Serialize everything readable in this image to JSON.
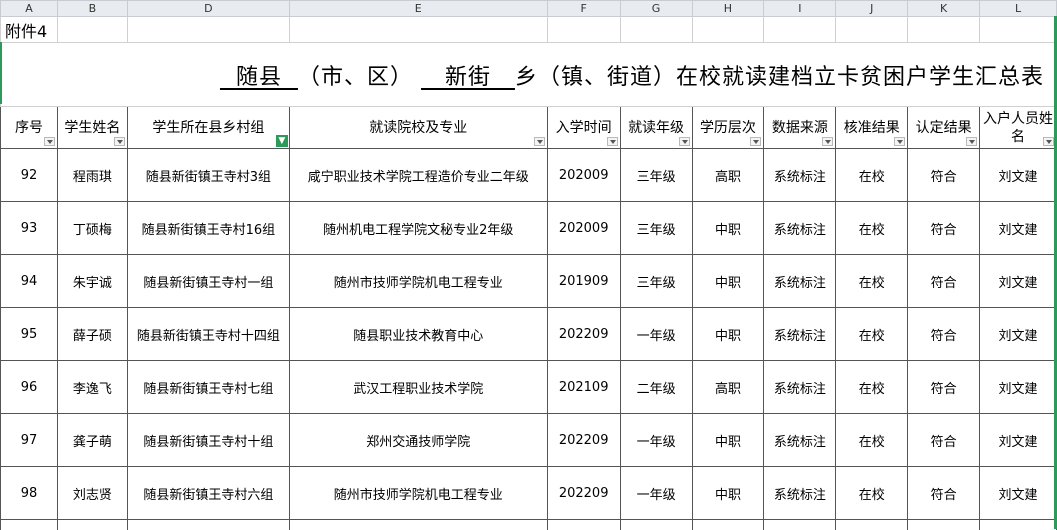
{
  "column_headers": [
    "A",
    "B",
    "D",
    "E",
    "F",
    "G",
    "H",
    "I",
    "J",
    "K",
    "L"
  ],
  "attachment_label": "附件4",
  "title": {
    "county": "随县",
    "part1": "（市、区）",
    "town": "新街",
    "part2": "乡（镇、街道）在校就读建档立卡贫困户学生汇总表"
  },
  "table_headers": [
    "序号",
    "学生姓名",
    "学生所在县乡村组",
    "就读院校及专业",
    "入学时间",
    "就读年级",
    "学历层次",
    "数据来源",
    "核准结果",
    "认定结果",
    "入户人员姓名"
  ],
  "rows": [
    {
      "no": "92",
      "name": "程雨琪",
      "village": "随县新街镇王寺村3组",
      "school": "咸宁职业技术学院工程造价专业二年级",
      "enroll": "202009",
      "grade": "三年级",
      "level": "高职",
      "source": "系统标注",
      "check": "在校",
      "result": "符合",
      "visitor": "刘文建"
    },
    {
      "no": "93",
      "name": "丁硕梅",
      "village": "随县新街镇王寺村16组",
      "school": "随州机电工程学院文秘专业2年级",
      "enroll": "202009",
      "grade": "三年级",
      "level": "中职",
      "source": "系统标注",
      "check": "在校",
      "result": "符合",
      "visitor": "刘文建"
    },
    {
      "no": "94",
      "name": "朱宇诚",
      "village": "随县新街镇王寺村一组",
      "school": "随州市技师学院机电工程专业",
      "enroll": "201909",
      "grade": "三年级",
      "level": "中职",
      "source": "系统标注",
      "check": "在校",
      "result": "符合",
      "visitor": "刘文建"
    },
    {
      "no": "95",
      "name": "薛子硕",
      "village": "随县新街镇王寺村十四组",
      "school": "随县职业技术教育中心",
      "enroll": "202209",
      "grade": "一年级",
      "level": "中职",
      "source": "系统标注",
      "check": "在校",
      "result": "符合",
      "visitor": "刘文建"
    },
    {
      "no": "96",
      "name": "李逸飞",
      "village": "随县新街镇王寺村七组",
      "school": "武汉工程职业技术学院",
      "enroll": "202109",
      "grade": "二年级",
      "level": "高职",
      "source": "系统标注",
      "check": "在校",
      "result": "符合",
      "visitor": "刘文建"
    },
    {
      "no": "97",
      "name": "龚子萌",
      "village": "随县新街镇王寺村十组",
      "school": "郑州交通技师学院",
      "enroll": "202209",
      "grade": "一年级",
      "level": "中职",
      "source": "系统标注",
      "check": "在校",
      "result": "符合",
      "visitor": "刘文建"
    },
    {
      "no": "98",
      "name": "刘志贤",
      "village": "随县新街镇王寺村六组",
      "school": "随州市技师学院机电工程专业",
      "enroll": "202209",
      "grade": "一年级",
      "level": "中职",
      "source": "系统标注",
      "check": "在校",
      "result": "符合",
      "visitor": "刘文建"
    }
  ],
  "colors": {
    "header_bg": "#e8ecf1",
    "filter_green": "#2e9a5a",
    "border": "#555555"
  }
}
